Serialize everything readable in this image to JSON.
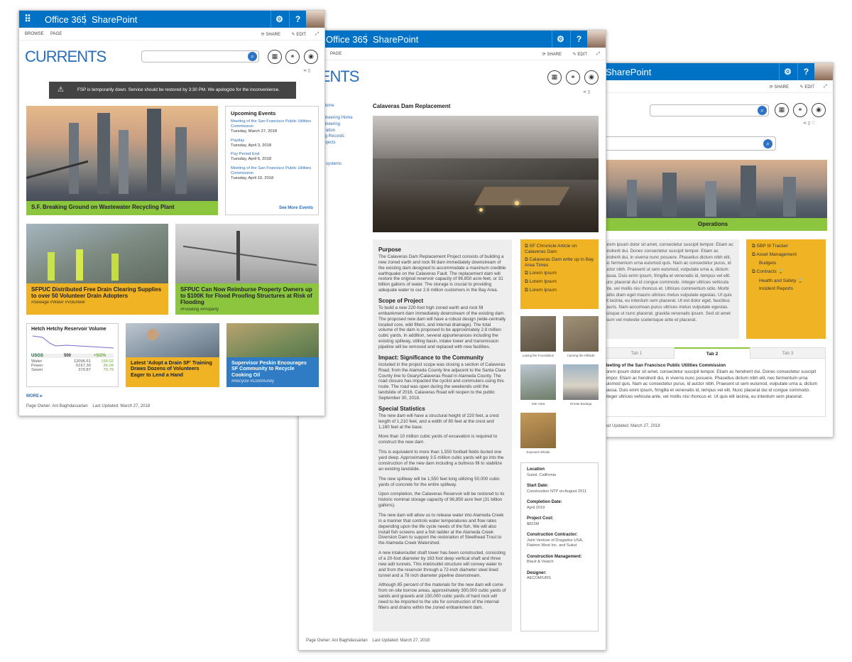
{
  "win3": {
    "app": "SharePoint",
    "icons": {
      "settings": "gear-icon",
      "help": "help-icon"
    },
    "cmd": {
      "share": "SHARE",
      "edit": "EDIT"
    },
    "hero_caption": "Operations",
    "intro": "Lorem ipsum dolor sit amet, consectetur suscipit tempor. Etiam ac hendrerit dui. Donec consectetur suscipit tempor. Etiam ac hendrerit dui, in viverra nunc posuere. Phasellus dictum nibh elit, nec fermentum urna euismod quis. Nam ac consectetur purus, id auctor nibh. Praesent ut sem euismod, vulputate urna a, dictum massa. Duis enim ipsum, fringilla et venenatis id, tempus vel elit. Nunc placerat dui id congue commodo. Integer ultrices vehicula ante, vel mollis nisi rhoncus et. Ultrices commentum odio. Morbi mattis diam eget mauris ultrices metus vulputate egestas. Ut quis elit lacinia, eu interdum sem placerat. Ut est dolor eget, faucibus mauris. Nam accumsan purus ultrices metus vulputate egestas. Quisque ut nunc placerat, gravida venenatis ipsum. Sed sit amet ipsum vel molestie scelerisque ante et placerat.",
    "links": [
      "SBP III Tracker",
      "Asset Management",
      "Budgets",
      "Contracts",
      "Health and Safety",
      "Incident Reports"
    ],
    "tabs": [
      "Tab 1",
      "Tab 2",
      "Tab 3"
    ],
    "tab_title": "Meeting of the San Francisco Public Utilities Commission",
    "tab_body": "Lorem ipsum dolor sit amet, consectetur suscipit tempor. Etiam ac hendrerit dui. Donec consectetur suscipit tempor. Etiam ac hendrerit dui, in viverra nunc posuere. Phasellus dictum nibh elit, nec fermentum urna euismod quis. Nam ac consectetur purus, id auctor nibh. Praesent ut sem euismod, vulputate urna a, dictum massa. Duis enim ipsum, fringilla et venenatis id, tempus vel elit. Nunc placerat dui id congue commodo. Integer ultrices vehicula ante, vel mollis nisi rhoncus et. Ut quis elit lacinia, eu interdum sem placerat.",
    "footer": "Last Updated: March 27, 2018"
  },
  "win2": {
    "brand": "Office 365",
    "app": "SharePoint",
    "cmd": {
      "page": "PAGE",
      "share": "SHARE",
      "edit": "EDIT"
    },
    "logo_partial": "RRENTS",
    "nav": [
      "r Home",
      "g",
      "ngineering Home",
      "ngineering",
      "istration",
      "ring Records",
      "Projects",
      "t",
      "ce",
      "systems"
    ],
    "title": "Calaveras Dam Replacement",
    "sections": [
      {
        "h": "Purpose",
        "p": "The Calaveras Dam Replacement Project consists of building a new zoned earth and rock fill dam immediately downstream of the existing dam designed to accommodate a maximum credible earthquake on the Calaveras Fault. The replacement dam will restore the original reservoir capacity of 96,850 acre-feet, or 31 billion gallons of water. The storage is crucial to providing adequate water to our 2.6 million customers in the Bay Area."
      },
      {
        "h": "Scope of Project",
        "p": "To build a new 220-foot high zoned earth and rock fill embankment dam immediately downstream of the existing dam. The proposed new dam will have a robust design (wide-centrally located core, wild filters, and internal drainage). The total volume of the dam is proposed to be approximately 2.8 million cubic yards. In addition, several appurtenances including the existing spillway, stilling basin, intake tower and transmission pipeline will be removed and replaced with new facilities."
      },
      {
        "h": "Impact: Significance to the Community",
        "p": "Included in the project scope was closing a section of Calaveras Road, from the Alameda County line adjacent to the Santa Clara County line to Geary/Calaveras Road in Alameda County. The road closure has impacted the cyclist and commuters using this route. The road was open during the weekends until the landslide of 2016. Calaveras Road will reopen to the public September 30, 2018."
      },
      {
        "h": "Special Statistics",
        "p": "The new dam will have a structural height of 220 feet, a crest length of 1,210 feet, and a width of 80 feet at the crest and 1,180 feet at the base."
      }
    ],
    "paras": [
      "More than 10 million cubic yards of excavation is required to construct the new dam.",
      "This is equivalent to more than 1,550 football fields buried one yard deep. Approximately 3.5 million cubic yards will go into the construction of the new dam including a buttress fill to stabilize an existing landslide.",
      "The new spillway will be 1,550 feet long utilizing 50,000 cubic yards of concrete for the entire spillway.",
      "Upon completion, the Calaveras Reservoir will be restored to its historic nominal storage capacity of 96,850 acre feet (31 billion gallons).",
      "The new dam will allow us to release water into Alameda Creek in a manner that controls water temperatures and flow rates depending upon the life cycle needs of the fish. We will also install fish screens and a fish ladder at the Alameda Creek Diversion Dam to support the restoration of Steelhead Trout to the Alameda Creek Watershed.",
      "A new intake/outlet shaft tower has been constructed, consisting of a 20-foot diameter by 163 foot deep vertical shaft and three new adit tunnels. This inlet/outlet structure will convey water to and from the reservoir through a 72-inch diameter steel lined tunnel and a 78 inch diameter pipeline downstream.",
      "Although 85 percent of the materials for the new dam will come from on-site borrow areas, approximately 300,000 cubic yards of sands and gravels and 150,000 cubic yards of hard rock will need to be imported to the site for construction of the internal filters and drains within the zoned embankment dam."
    ],
    "side_links": [
      "SF Chronicle Article on Calaveras Dam",
      "Calaveras Dam write up in Bay Area Times",
      "Lorem Ipsum",
      "Lorem Ipsum",
      "Lorem Ipsum"
    ],
    "thumbs": [
      "Laying the Foundation",
      "Carving the Hillside",
      "Site View",
      "Ornate Bodega",
      "Exposed Hillside"
    ],
    "facts": [
      {
        "k": "Location",
        "v": "Sunol, California"
      },
      {
        "k": "Start Date:",
        "v": "Construction NTP on August 2011"
      },
      {
        "k": "Completion Date:",
        "v": "April 2019"
      },
      {
        "k": "Project Cost:",
        "v": "$823M"
      },
      {
        "k": "Construction Contractor:",
        "v": "Joint Venture of Dragados USA, Flatiron West Inc. and Sukut"
      },
      {
        "k": "Construction Management:",
        "v": "Black & Veatch"
      },
      {
        "k": "Designer:",
        "v": "AECOM/URS"
      }
    ],
    "footer": "Page Owner: Ani Baghdassarian    Last Updated: March 27, 2018"
  },
  "win1": {
    "brand": "Office 365",
    "app": "SharePoint",
    "cmd": {
      "browse": "BROWSE",
      "page": "PAGE",
      "share": "SHARE",
      "edit": "EDIT"
    },
    "logo": "CURRENTS",
    "alert": "FSP is temporarily down. Service should be restored by 3:30 PM. We apologize for the inconvenience.",
    "hero_caption": "S.F. Breaking Ground on Wastewater Recycling Plant",
    "events_title": "Upcoming Events",
    "events": [
      {
        "name": "Meeting of the San Francisco Public Utilities Commission",
        "date": "Tuesday, March 27, 2018"
      },
      {
        "name": "Payday",
        "date": "Tuesday, April 3, 2018"
      },
      {
        "name": "Pay Period End",
        "date": "Tuesday, April 6, 2018"
      },
      {
        "name": "Meeting of the San Francisco Public Utilities Commission",
        "date": "Tuesday, April 10, 2018"
      }
    ],
    "see_more": "See More Events",
    "news": [
      {
        "title": "SFPUC Distributed Free Drain Clearing Supplies to over 50 Volunteer Drain Adopters",
        "tags": "#Sewage  #Water  #Volunteer"
      },
      {
        "title": "SFPUC Can Now Reimburse Property Owners up to $100K for Flood Proofing Structures at Risk of Flooding",
        "tags": "#Flooding  #Property"
      }
    ],
    "widget": {
      "title": "Hetch Hetchy Reservoir Volume",
      "usgs": "USGS",
      "head_value": "500",
      "head_delta": "+5/2%",
      "rows": [
        {
          "k": "Water",
          "v": "12096.61",
          "d": "156.02"
        },
        {
          "k": "Power",
          "v": "5167.30",
          "d": "36.04"
        },
        {
          "k": "Sewer",
          "v": "370.87",
          "d": "79.79"
        }
      ]
    },
    "news2": [
      {
        "title": "Latest 'Adopt a Drain SF' Training Draws Dozens of Volunteers Eager to Lend a Hand",
        "tags": ""
      },
      {
        "title": "Supervisor Peskin Encourages SF Community to Recycle Cooking Oil",
        "tags": "#Recycle  #Community"
      }
    ],
    "more": "MORE ▸",
    "footer": "Page Owner: Ani Baghdassarian    Last Updated: March 27, 2018"
  }
}
